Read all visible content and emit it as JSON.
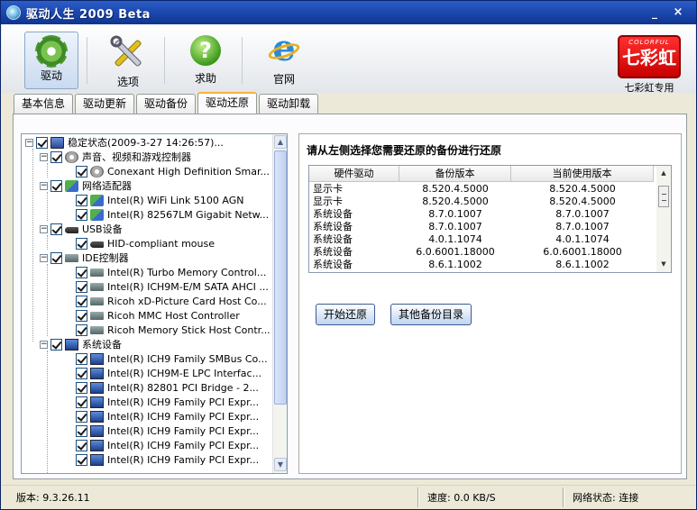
{
  "window": {
    "title": "驱动人生 2009 Beta",
    "minimize": "_",
    "close": "×"
  },
  "toolbar": {
    "items": [
      {
        "label": "驱动",
        "icon": "gear-icon",
        "active": true
      },
      {
        "label": "选项",
        "icon": "tools-icon"
      },
      {
        "label": "求助",
        "icon": "help-icon",
        "glyph": "?"
      },
      {
        "label": "官网",
        "icon": "ie-icon",
        "glyph": "e"
      }
    ]
  },
  "brand": {
    "logo_small": "COLORFUL",
    "logo_big": "七彩虹",
    "caption": "七彩虹专用"
  },
  "tabs": [
    {
      "label": "基本信息"
    },
    {
      "label": "驱动更新"
    },
    {
      "label": "驱动备份"
    },
    {
      "label": "驱动还原",
      "active": true
    },
    {
      "label": "驱动卸载"
    }
  ],
  "tree": {
    "root": "稳定状态(2009-3-27 14:26:57)...",
    "groups": [
      {
        "label": "声音、视频和游戏控制器",
        "icon": "speaker-icon",
        "items": [
          "Conexant High Definition Smar..."
        ]
      },
      {
        "label": "网络适配器",
        "icon": "network-icon",
        "items": [
          "Intel(R) WiFi Link 5100 AGN",
          "Intel(R) 82567LM Gigabit Netw..."
        ]
      },
      {
        "label": "USB设备",
        "icon": "usb-icon",
        "items": [
          "HID-compliant mouse"
        ]
      },
      {
        "label": "IDE控制器",
        "icon": "ide-icon",
        "items": [
          "Intel(R) Turbo Memory Control...",
          "Intel(R) ICH9M-E/M SATA AHCI ...",
          "Ricoh xD-Picture Card Host Co...",
          "Ricoh MMC Host Controller",
          "Ricoh Memory Stick Host Contr..."
        ]
      },
      {
        "label": "系统设备",
        "icon": "system-icon",
        "items": [
          "Intel(R) ICH9 Family SMBus Co...",
          "Intel(R) ICH9M-E LPC Interfac...",
          "Intel(R) 82801 PCI Bridge - 2...",
          "Intel(R) ICH9 Family PCI Expr...",
          "Intel(R) ICH9 Family PCI Expr...",
          "Intel(R) ICH9 Family PCI Expr...",
          "Intel(R) ICH9 Family PCI Expr...",
          "Intel(R) ICH9 Family PCI Expr..."
        ]
      }
    ]
  },
  "restore": {
    "title": "请从左侧选择您需要还原的备份进行还原",
    "columns": [
      "硬件驱动",
      "备份版本",
      "当前使用版本"
    ],
    "rows": [
      [
        "显示卡",
        "8.520.4.5000",
        "8.520.4.5000"
      ],
      [
        "显示卡",
        "8.520.4.5000",
        "8.520.4.5000"
      ],
      [
        "系统设备",
        "8.7.0.1007",
        "8.7.0.1007"
      ],
      [
        "系统设备",
        "8.7.0.1007",
        "8.7.0.1007"
      ],
      [
        "系统设备",
        "4.0.1.1074",
        "4.0.1.1074"
      ],
      [
        "系统设备",
        "6.0.6001.18000",
        "6.0.6001.18000"
      ],
      [
        "系统设备",
        "8.6.1.1002",
        "8.6.1.1002"
      ]
    ],
    "start_button": "开始还原",
    "other_button": "其他备份目录"
  },
  "status": {
    "version": "版本: 9.3.26.11",
    "speed": "速度: 0.0 KB/S",
    "network": "网络状态: 连接"
  }
}
